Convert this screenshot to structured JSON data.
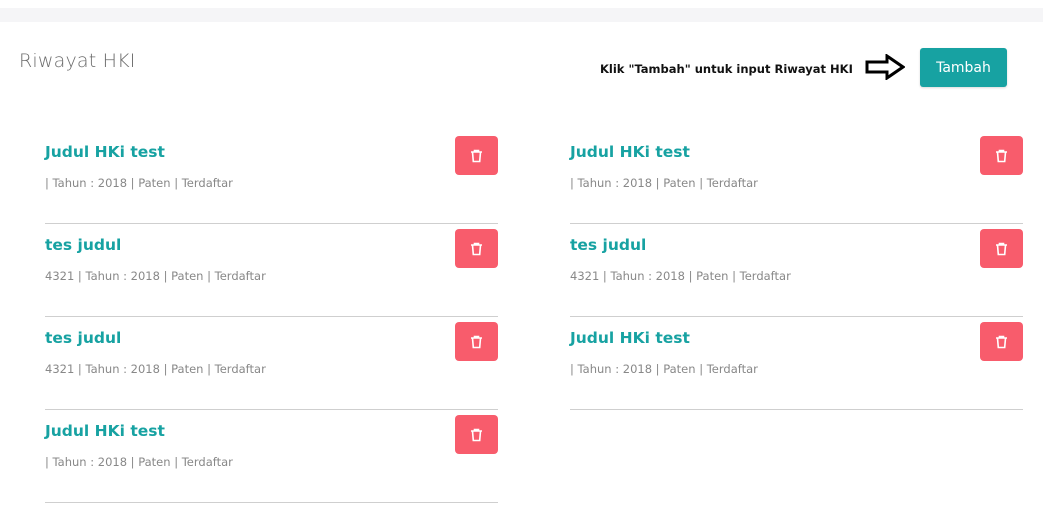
{
  "header": {
    "title": "Riwayat HKI",
    "hint": "Klik \"Tambah\" untuk input Riwayat HKI",
    "add_label": "Tambah",
    "accent": "#17a2a2",
    "delete_color": "#f85c6c"
  },
  "list_left": [
    {
      "title": "Judul HKi test",
      "meta": "| Tahun : 2018 | Paten | Terdaftar"
    },
    {
      "title": "tes judul",
      "meta": "4321 | Tahun : 2018 | Paten | Terdaftar"
    },
    {
      "title": "tes judul",
      "meta": "4321 | Tahun : 2018 | Paten | Terdaftar"
    },
    {
      "title": "Judul HKi test",
      "meta": "| Tahun : 2018 | Paten | Terdaftar"
    }
  ],
  "list_right": [
    {
      "title": "Judul HKi test",
      "meta": "| Tahun : 2018 | Paten | Terdaftar"
    },
    {
      "title": "tes judul",
      "meta": "4321 | Tahun : 2018 | Paten | Terdaftar"
    },
    {
      "title": "Judul HKi test",
      "meta": "| Tahun : 2018 | Paten | Terdaftar"
    }
  ],
  "icons": {
    "delete": "trash-icon",
    "arrow": "arrow-right-icon"
  }
}
